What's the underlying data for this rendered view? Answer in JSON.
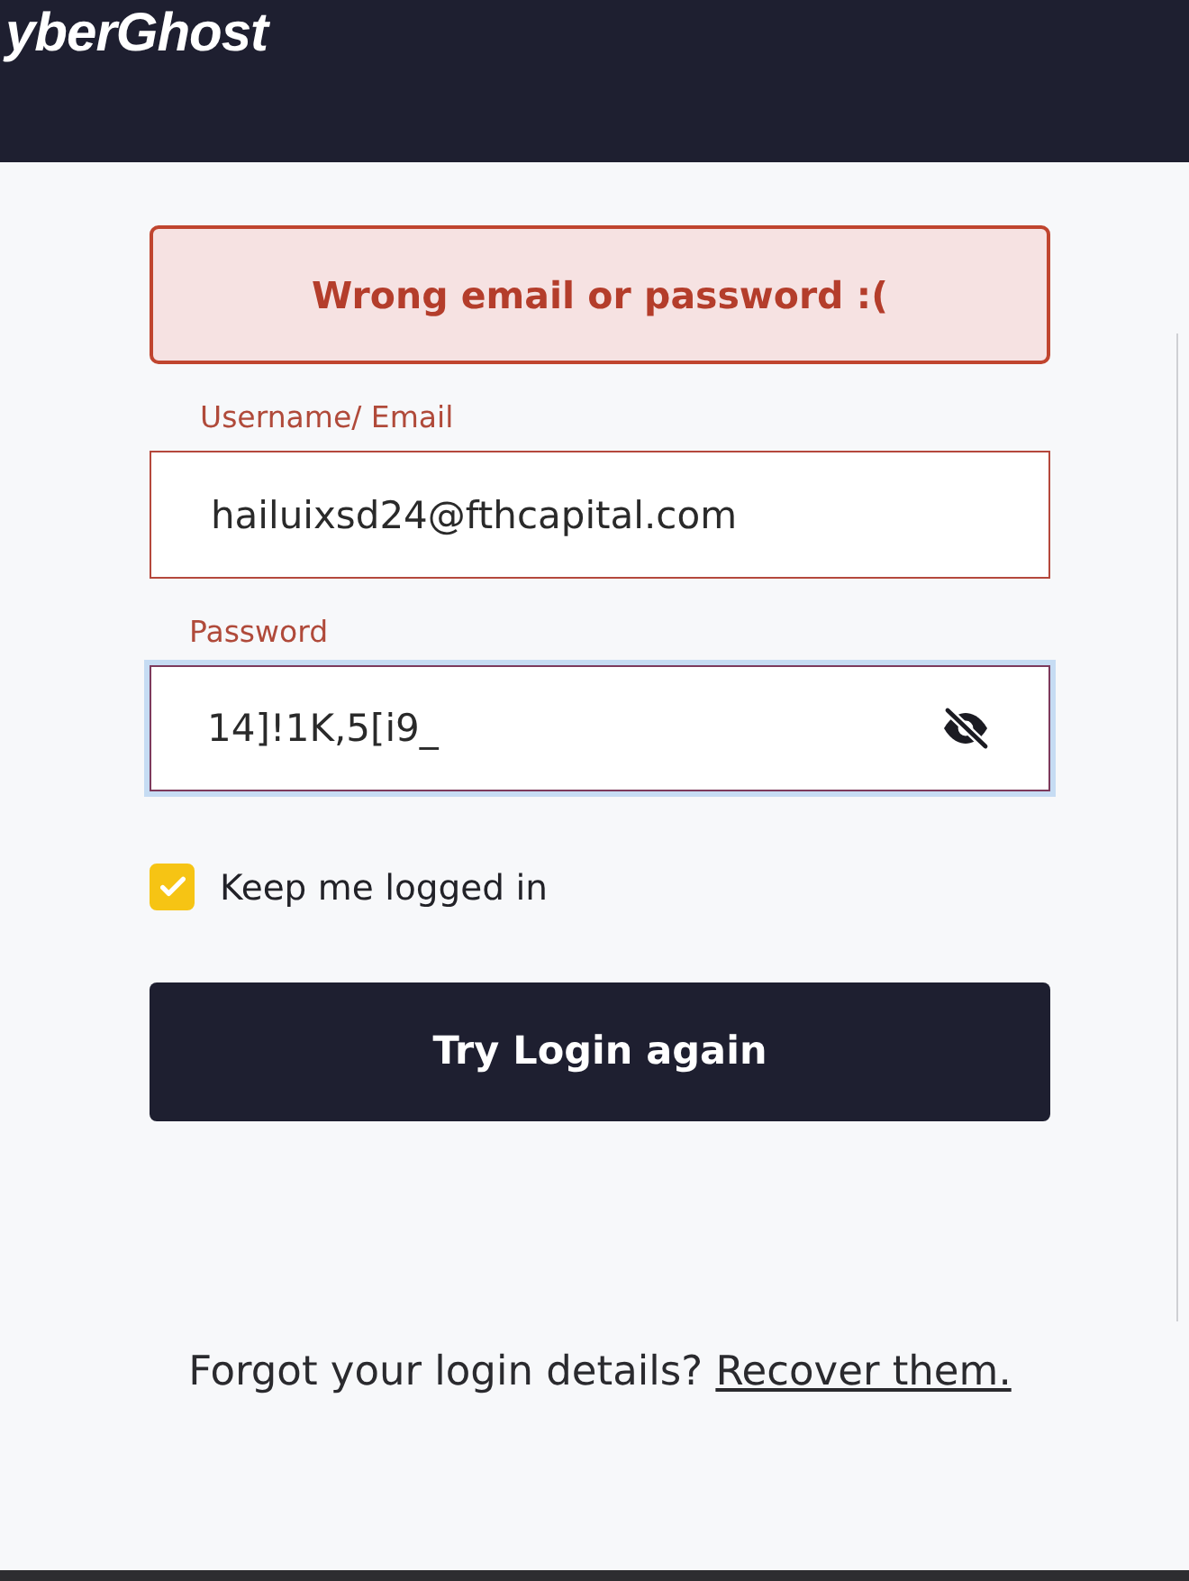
{
  "header": {
    "logo": "yberGhost"
  },
  "alert": {
    "message": "Wrong email or password :("
  },
  "fields": [
    {
      "kind": "text",
      "label": "Username/ Email",
      "value": "hailuixsd24@fthcapital.com",
      "focused": false
    },
    {
      "kind": "password",
      "label": "Password",
      "value": "14]!1K,5[i9_",
      "focused": true
    }
  ],
  "remember": {
    "label": "Keep me logged in",
    "checked": true
  },
  "submit": {
    "label": "Try Login again"
  },
  "footer": {
    "text": "Forgot your login details?",
    "link": "Recover them."
  }
}
